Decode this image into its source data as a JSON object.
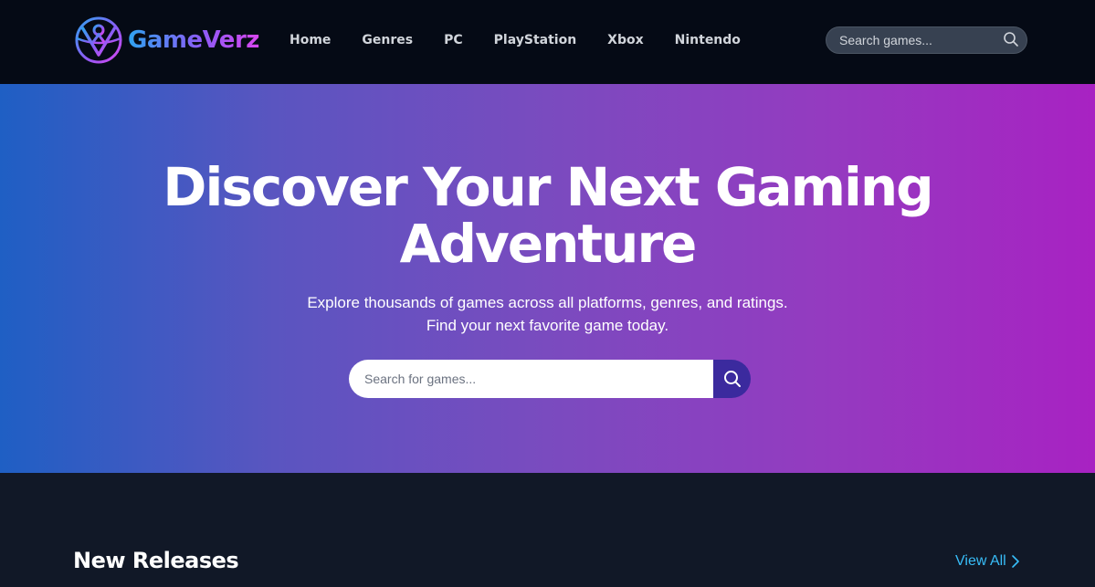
{
  "brand": {
    "name": "GameVerz",
    "accent_from": "#2fa3f0",
    "accent_to": "#d946ef"
  },
  "nav": {
    "links": [
      "Home",
      "Genres",
      "PC",
      "PlayStation",
      "Xbox",
      "Nintendo"
    ],
    "search_placeholder": "Search games...",
    "search_icon": "search-icon"
  },
  "hero": {
    "title_line1": "Discover Your Next Gaming",
    "title_line2": "Adventure",
    "subtitle_line1": "Explore thousands of games across all platforms, genres, and ratings.",
    "subtitle_line2": "Find your next favorite game today.",
    "search_placeholder": "Search for games...",
    "gradient_from": "#1f5fc4",
    "gradient_to": "#a822c2",
    "search_button_color": "#3b2a9e"
  },
  "new_releases": {
    "title": "New Releases",
    "view_all_label": "View All",
    "view_all_icon": "chevron-right-icon",
    "link_color": "#38bdf8"
  }
}
